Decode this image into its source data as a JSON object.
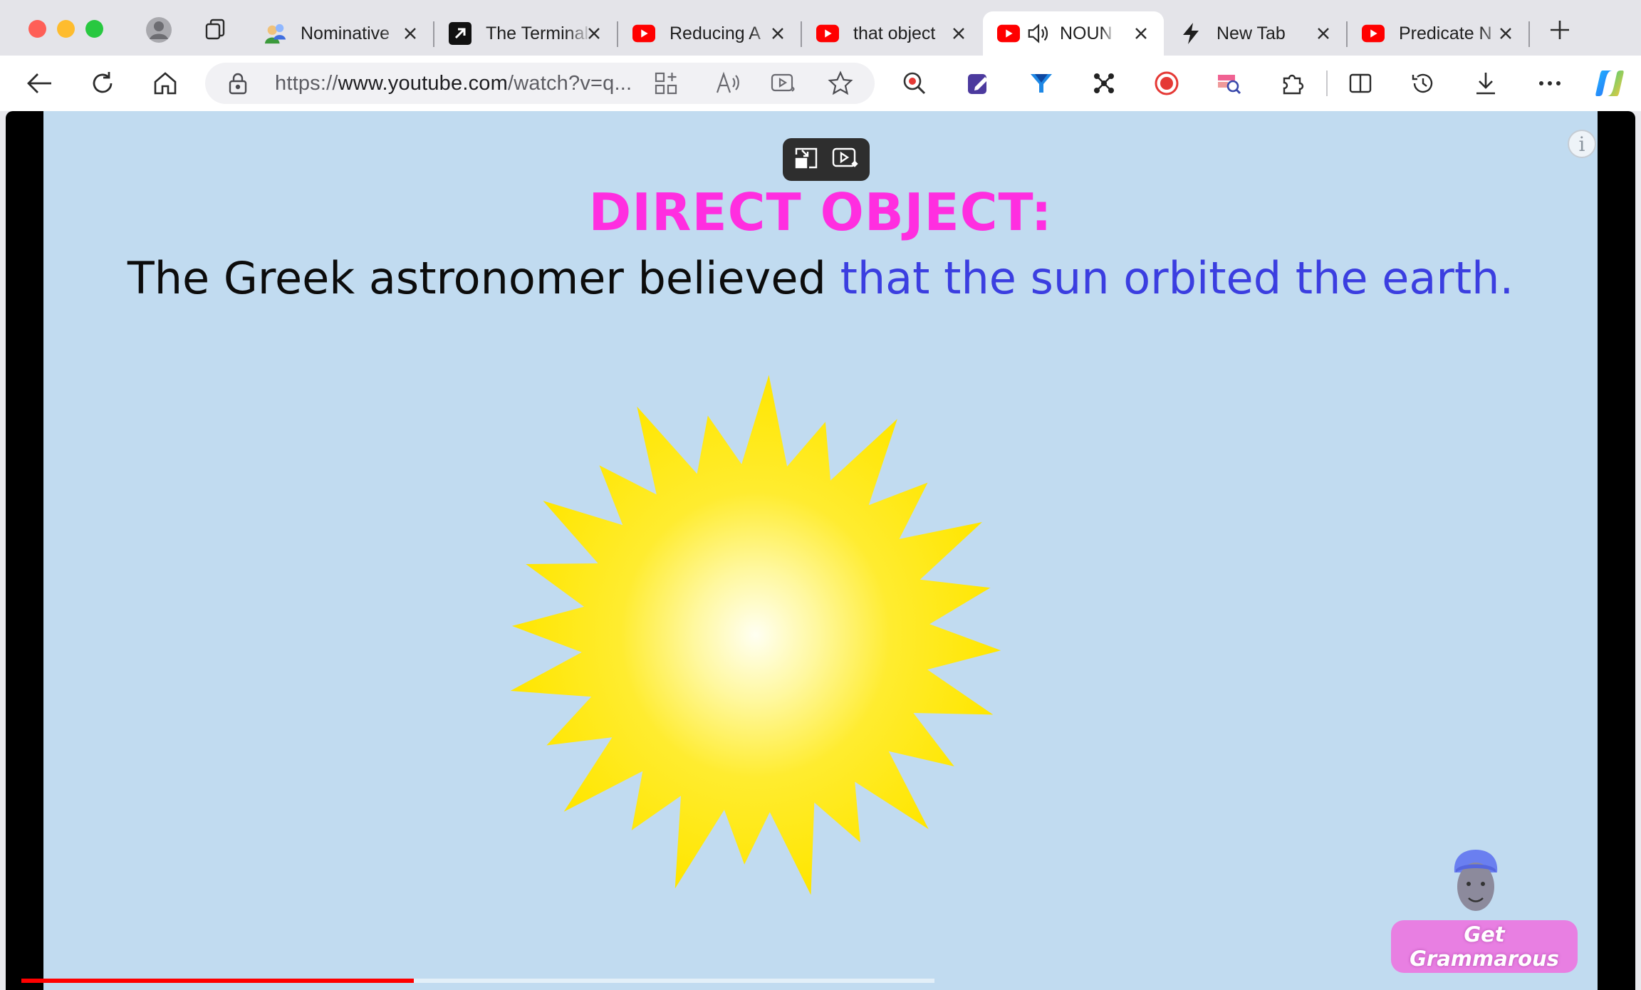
{
  "window": {
    "traffic_colors": [
      "#fe5f57",
      "#febc2e",
      "#28c840"
    ]
  },
  "tabs": [
    {
      "title": "Nominative",
      "favicon": "user-group-icon",
      "active": false
    },
    {
      "title": "The Terminal",
      "favicon": "arrow-square-icon",
      "active": false
    },
    {
      "title": "Reducing A",
      "favicon": "youtube-icon",
      "active": false
    },
    {
      "title": "that object",
      "favicon": "youtube-icon",
      "active": false
    },
    {
      "title": "NOUN",
      "favicon": "youtube-icon",
      "active": true,
      "audio": "speaker-icon"
    },
    {
      "title": "New Tab",
      "favicon": "lightning-icon",
      "active": false
    },
    {
      "title": "Predicate N",
      "favicon": "youtube-icon",
      "active": false
    }
  ],
  "address_bar": {
    "url_prefix": "https://",
    "url_host": "www.youtube.com",
    "url_path": "/watch?v=q..."
  },
  "video": {
    "heading": "DIRECT OBJECT:",
    "sentence_part1": "The Greek astronomer believed",
    "sentence_part2": "that the sun orbited the earth.",
    "info_glyph": "i",
    "brand": "Get Grammarous",
    "progress": 0.43,
    "colors": {
      "background": "#c1dbf0",
      "heading": "#ff2ee0",
      "highlight": "#3b3ee0",
      "sun": "#ffe600",
      "progress": "#ff0000"
    }
  }
}
